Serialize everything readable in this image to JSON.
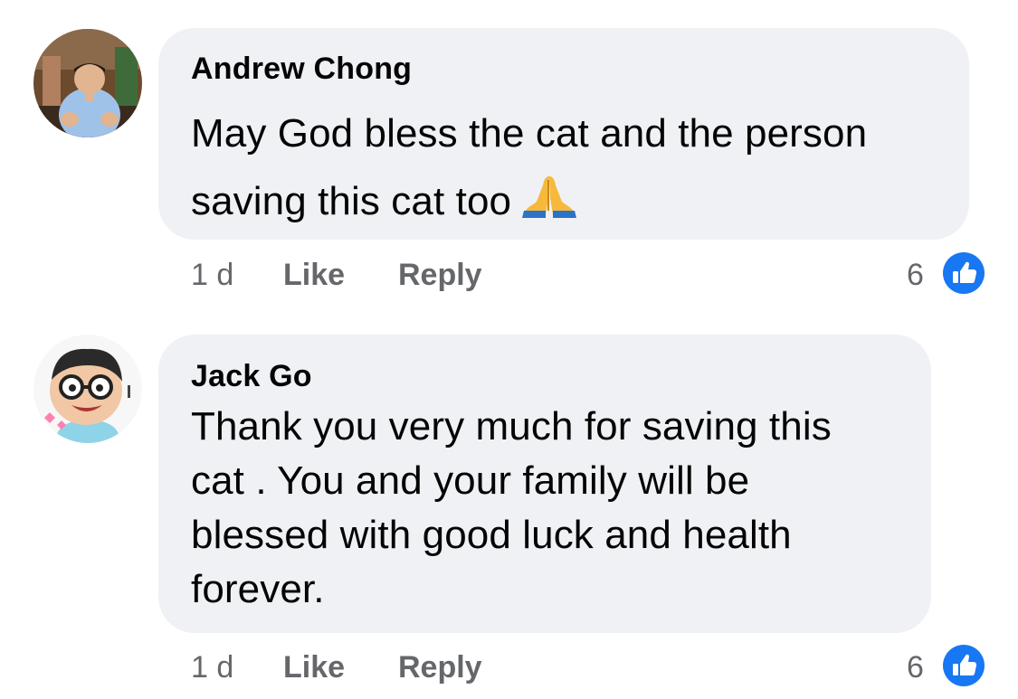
{
  "colors": {
    "bubble_bg": "#eff1f4",
    "text": "#050505",
    "meta_text": "#65676b",
    "like_blue": "#1877f2"
  },
  "comments": [
    {
      "author": "Andrew Chong",
      "text_lines": [
        "May God bless the cat and the person",
        "saving this cat too"
      ],
      "emoji": "folded-hands-icon",
      "time": "1 d",
      "like_label": "Like",
      "reply_label": "Reply",
      "reaction_count": "6",
      "reaction_icon": "thumbs-up-icon"
    },
    {
      "author": "Jack Go",
      "text_lines": [
        "Thank you very much for saving this",
        "cat . You and your family will be",
        "blessed with good luck and health",
        "forever."
      ],
      "time": "1 d",
      "like_label": "Like",
      "reply_label": "Reply",
      "reaction_count": "6",
      "reaction_icon": "thumbs-up-icon"
    }
  ]
}
